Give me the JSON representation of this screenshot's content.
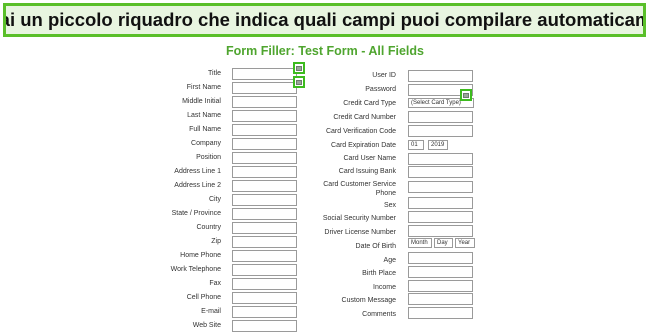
{
  "banner": {
    "text": "Vedrai un piccolo riquadro che indica quali campi puoi compilare automaticamente"
  },
  "form": {
    "title": "Form Filler: Test Form - All Fields"
  },
  "left_fields": [
    {
      "label": "Title"
    },
    {
      "label": "First Name"
    },
    {
      "label": "Middle Initial"
    },
    {
      "label": "Last Name"
    },
    {
      "label": "Full Name"
    },
    {
      "label": "Company"
    },
    {
      "label": "Position"
    },
    {
      "label": "Address Line 1"
    },
    {
      "label": "Address Line 2"
    },
    {
      "label": "City"
    },
    {
      "label": "State / Province"
    },
    {
      "label": "Country"
    },
    {
      "label": "Zip"
    },
    {
      "label": "Home Phone"
    },
    {
      "label": "Work Telephone"
    },
    {
      "label": "Fax"
    },
    {
      "label": "Cell Phone"
    },
    {
      "label": "E-mail"
    },
    {
      "label": "Web Site"
    }
  ],
  "right_fields": {
    "user_id": "User ID",
    "password": "Password",
    "card_type": "Credit Card Type",
    "card_type_value": "(Select Card Type)",
    "card_number": "Credit Card Number",
    "card_verification": "Card Verification Code",
    "card_expiration": "Card Expiration Date",
    "exp_month_value": "01",
    "exp_year_value": "2019",
    "card_user_name": "Card User Name",
    "card_issuing_bank": "Card Issuing Bank",
    "card_service_phone_1": "Card Customer Service",
    "card_service_phone_2": "Phone",
    "sex": "Sex",
    "ssn": "Social Security Number",
    "driver_license": "Driver License Number",
    "dob": "Date Of Birth",
    "dob_month": "Month",
    "dob_day": "Day",
    "dob_year": "Year",
    "age": "Age",
    "birth_place": "Birth Place",
    "income": "Income",
    "custom_message": "Custom Message",
    "comments": "Comments"
  },
  "icons": {
    "autofill": "autofill-icon"
  },
  "colors": {
    "accent": "#5abf2a",
    "title": "#4fa52f",
    "banner_bg": "#e8f5e0"
  }
}
